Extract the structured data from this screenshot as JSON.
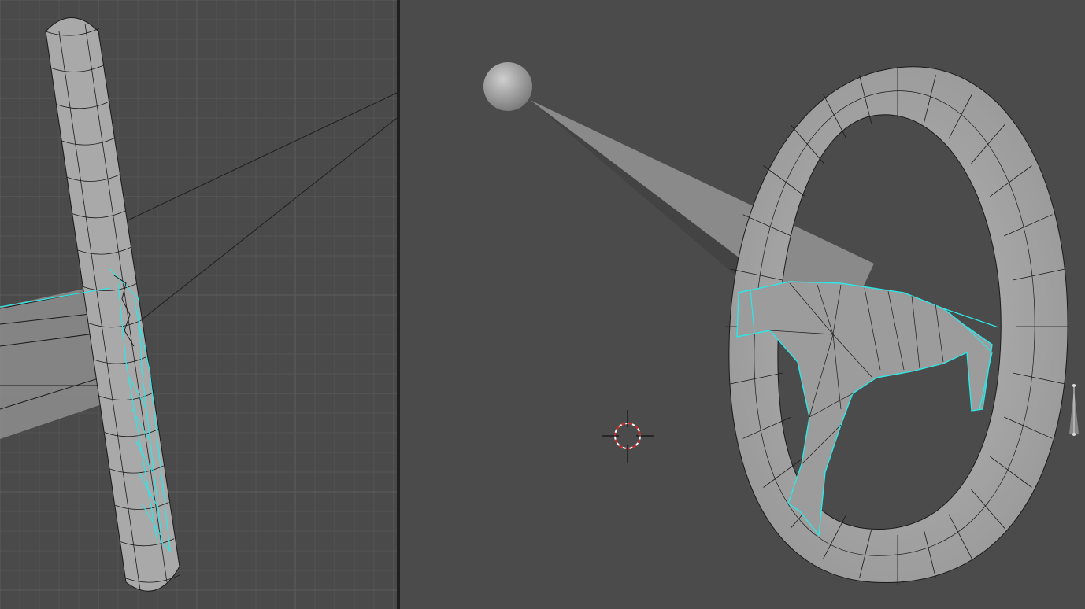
{
  "colors": {
    "viewport_background": "#4a4a4a",
    "grid_minor": "#545454",
    "grid_major": "#5c5c5c",
    "mesh_fill": "#a8a8a8",
    "wire": "#1a1a1a",
    "selection_highlight": "#2ee6e6",
    "cursor_ring": "#d22a2a",
    "divider": "#1f1f1f"
  },
  "viewports": [
    {
      "name": "left",
      "view": "side-orthographic",
      "grid": true,
      "content": [
        "steering-wheel-rim",
        "selected-spoke-mesh",
        "light-cone",
        "camera-frustum"
      ]
    },
    {
      "name": "right",
      "view": "perspective",
      "grid": false,
      "content": [
        "steering-wheel-rim",
        "selected-spoke-mesh",
        "spot-light",
        "light-cone",
        "3d-cursor",
        "scale-gizmo"
      ]
    }
  ]
}
